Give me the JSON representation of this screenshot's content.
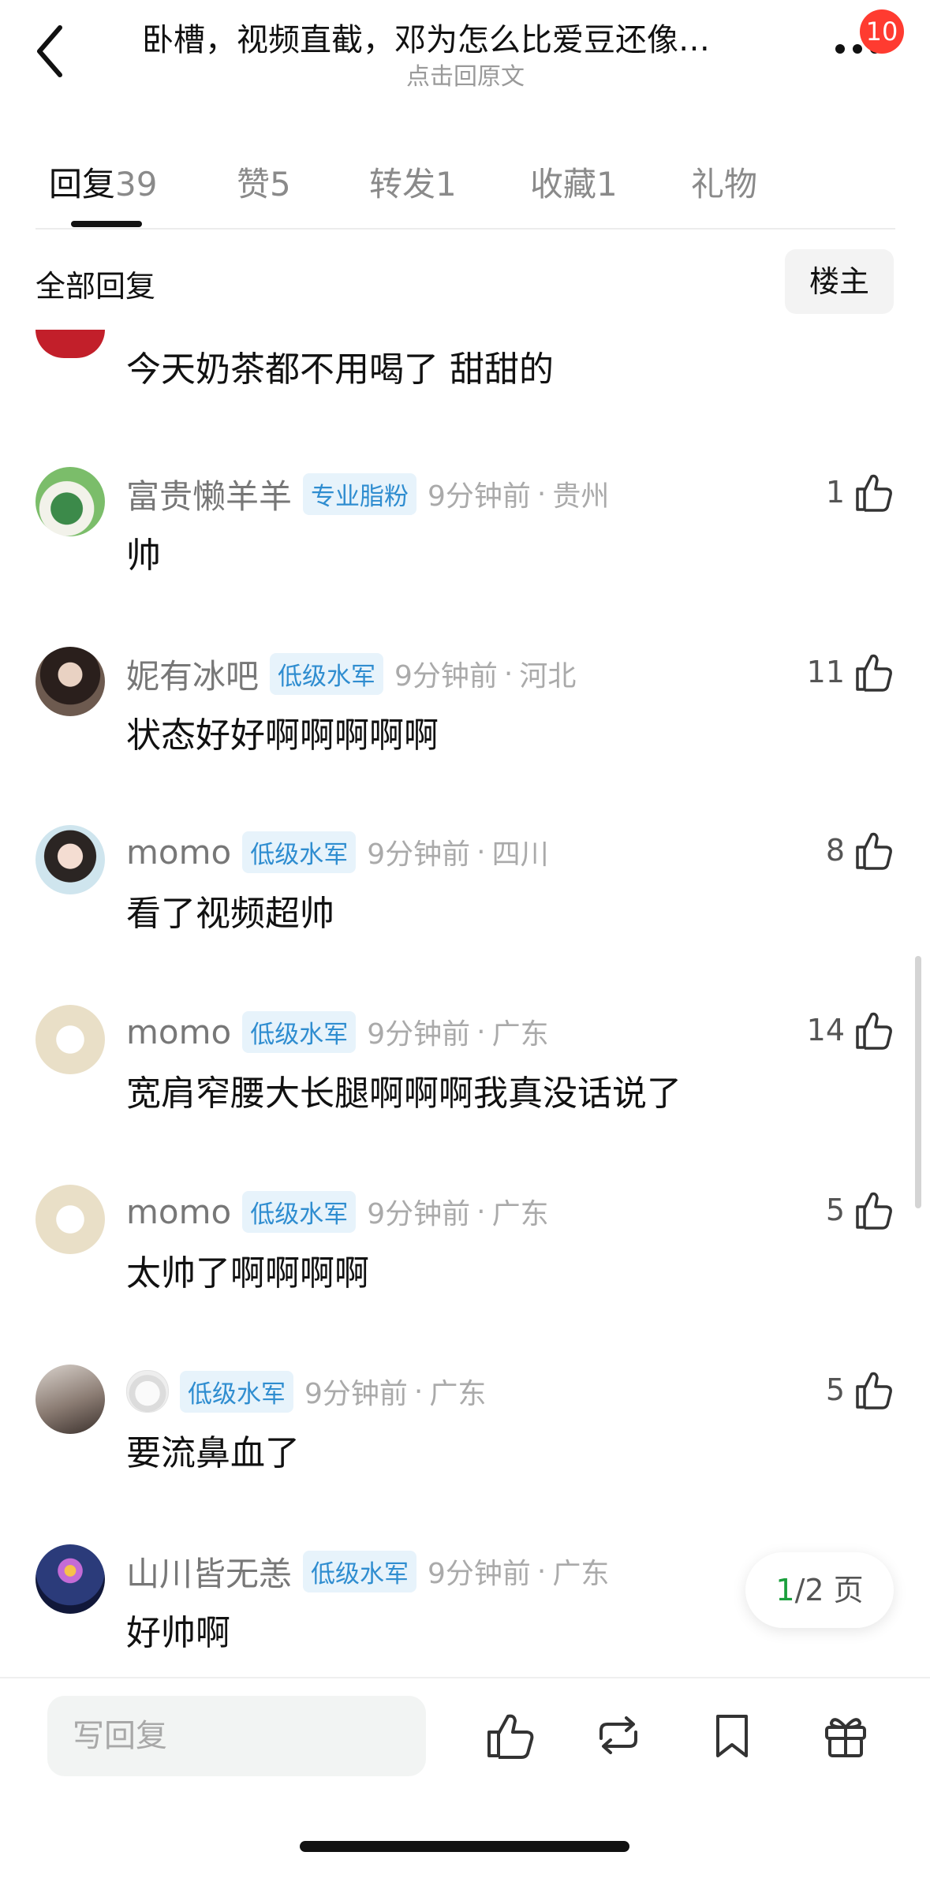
{
  "header": {
    "title": "卧槽，视频直截，邓为怎么比爱豆还像…",
    "subtitle": "点击回原文",
    "badge_count": "10"
  },
  "tabs": [
    {
      "label": "回复",
      "count": "39"
    },
    {
      "label": "赞",
      "count": "5"
    },
    {
      "label": "转发",
      "count": "1"
    },
    {
      "label": "收藏",
      "count": "1"
    },
    {
      "label": "礼物",
      "count": ""
    }
  ],
  "filter": {
    "all_replies": "全部回复",
    "owner_button": "楼主"
  },
  "partial_comment": {
    "text": "今天奶茶都不用喝了  甜甜的"
  },
  "comments": [
    {
      "name": "富贵懒羊羊",
      "tag": "专业脂粉",
      "time": "9分钟前",
      "sep": "·",
      "location": "贵州",
      "likes": "1",
      "text": "帅"
    },
    {
      "name": "妮有冰吧",
      "tag": "低级水军",
      "time": "9分钟前",
      "sep": "·",
      "location": "河北",
      "likes": "11",
      "text": "状态好好啊啊啊啊啊"
    },
    {
      "name": "momo",
      "tag": "低级水军",
      "time": "9分钟前",
      "sep": "·",
      "location": "四川",
      "likes": "8",
      "text": "看了视频超帅"
    },
    {
      "name": "momo",
      "tag": "低级水军",
      "time": "9分钟前",
      "sep": "·",
      "location": "广东",
      "likes": "14",
      "text": "宽肩窄腰大长腿啊啊啊我真没话说了"
    },
    {
      "name": "momo",
      "tag": "低级水军",
      "time": "9分钟前",
      "sep": "·",
      "location": "广东",
      "likes": "5",
      "text": "太帅了啊啊啊啊"
    },
    {
      "name": "",
      "tag": "低级水军",
      "time": "9分钟前",
      "sep": "·",
      "location": "广东",
      "likes": "5",
      "text": "要流鼻血了"
    },
    {
      "name": "山川皆无恙",
      "tag": "低级水军",
      "time": "9分钟前",
      "sep": "·",
      "location": "广东",
      "likes": "",
      "text": "好帅啊"
    }
  ],
  "pager": {
    "current": "1",
    "rest": "/2 页"
  },
  "bottom": {
    "reply_placeholder": "写回复",
    "icons": [
      "like-icon",
      "repost-icon",
      "bookmark-icon",
      "gift-icon"
    ]
  },
  "colors": {
    "accent_green": "#1a9f3c",
    "tag_blue": "#2f8dd0",
    "badge_red": "#ff3b30"
  }
}
